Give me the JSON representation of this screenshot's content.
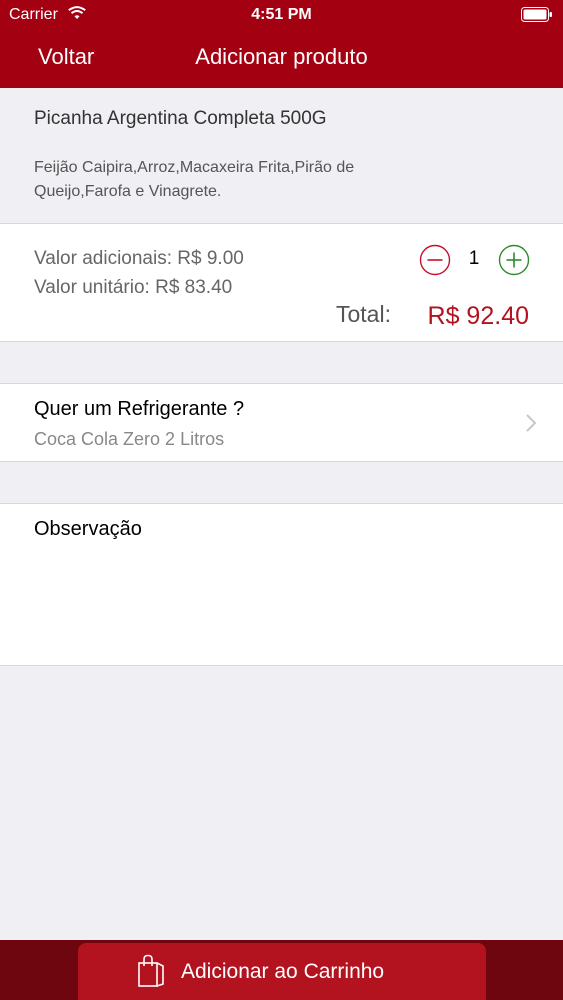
{
  "status_bar": {
    "carrier": "Carrier",
    "time": "4:51 PM"
  },
  "nav": {
    "back_label": "Voltar",
    "title": "Adicionar produto"
  },
  "product": {
    "name": "Picanha Argentina Completa 500G",
    "description": "Feijão Caipira,Arroz,Macaxeira Frita,Pirão de Queijo,Farofa e Vinagrete."
  },
  "values": {
    "additional": "Valor adicionais: R$ 9.00",
    "unit": "Valor unitário: R$ 83.40",
    "quantity": "1",
    "total_label": "Total:",
    "total_value": "R$ 92.40"
  },
  "soda": {
    "question": "Quer um Refrigerante ?",
    "selected": "Coca Cola Zero 2 Litros"
  },
  "observation": {
    "label": "Observação",
    "value": ""
  },
  "cart": {
    "button_label": "Adicionar ao Carrinho"
  },
  "colors": {
    "brand": "#a30012",
    "price": "#b3121f",
    "minus": "#c8102e",
    "plus": "#2e8b2e",
    "background": "#efeff4"
  }
}
